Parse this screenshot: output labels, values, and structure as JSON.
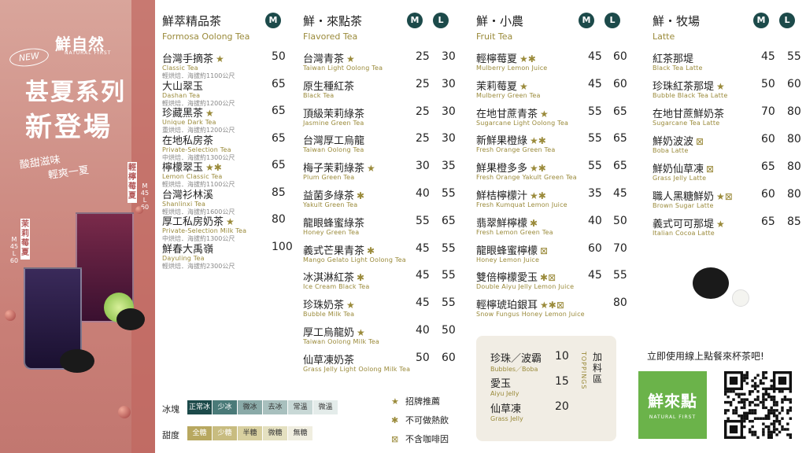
{
  "promo": {
    "logo": "鮮自然",
    "logo_sub": "NATURAL FIRST",
    "new_badge": "NEW",
    "headline_line1": "甚夏系列",
    "headline_line2": "新登場",
    "slogan_line1": "酸甜滋味",
    "slogan_line2": "輕爽一夏",
    "drink1_name": "輕檸莓夏",
    "drink1_sizes": "M 45 L 60",
    "drink2_name": "茉莉莓夏",
    "drink2_sizes": "M 45 L 60"
  },
  "columns": [
    {
      "title": "鮮萃精品茶",
      "subtitle": "Formosa Oolong Tea",
      "sizes": [
        "M"
      ],
      "items": [
        {
          "name": "台灣手摘茶",
          "marks": "★",
          "en": "Classic Tea",
          "note": "輕烘焙．海拔約1100公尺",
          "prices": [
            "50"
          ]
        },
        {
          "name": "大山翠玉",
          "marks": "",
          "en": "Dashan Tea",
          "note": "輕烘焙．海拔約1200公尺",
          "prices": [
            "65"
          ]
        },
        {
          "name": "珍藏黑茶",
          "marks": "★",
          "en": "Unique Dark Tea",
          "note": "重烘焙．海拔約1200公尺",
          "prices": [
            "65"
          ]
        },
        {
          "name": "在地私房茶",
          "marks": "",
          "en": "Private-Selection Tea",
          "note": "中烘焙．海拔約1300公尺",
          "prices": [
            "65"
          ]
        },
        {
          "name": "檸檬翠玉",
          "marks": "★✱",
          "en": "Lemon Classic Tea",
          "note": "輕烘焙．海拔約1100公尺",
          "prices": [
            "65"
          ]
        },
        {
          "name": "台灣衫林溪",
          "marks": "",
          "en": "Shanlinxi Tea",
          "note": "輕烘焙．海拔約1600公尺",
          "prices": [
            "85"
          ]
        },
        {
          "name": "厚工私房奶茶",
          "marks": "★",
          "en": "Private-Selection Milk Tea",
          "note": "中烘焙．海拔約1300公尺",
          "prices": [
            "80"
          ]
        },
        {
          "name": "鮮春大禹嶺",
          "marks": "",
          "en": "Dayuling Tea",
          "note": "輕烘焙．海拔約2300公尺",
          "prices": [
            "100"
          ]
        }
      ]
    },
    {
      "title": "鮮・來點茶",
      "subtitle": "Flavored Tea",
      "sizes": [
        "M",
        "L"
      ],
      "items": [
        {
          "name": "台灣青茶",
          "marks": "★",
          "en": "Taiwan Light Oolong Tea",
          "prices": [
            "25",
            "30"
          ]
        },
        {
          "name": "原生種紅茶",
          "marks": "",
          "en": "Black Tea",
          "prices": [
            "25",
            "30"
          ]
        },
        {
          "name": "頂級茉莉綠茶",
          "marks": "",
          "en": "Jasmine Green Tea",
          "prices": [
            "25",
            "30"
          ]
        },
        {
          "name": "台灣厚工烏龍",
          "marks": "",
          "en": "Taiwan Oolong Tea",
          "prices": [
            "25",
            "30"
          ]
        },
        {
          "name": "梅子茉莉綠茶",
          "marks": "★",
          "en": "Plum Green Tea",
          "prices": [
            "30",
            "35"
          ]
        },
        {
          "name": "益菌多綠茶",
          "marks": "✱",
          "en": "Yakult Green Tea",
          "prices": [
            "40",
            "55"
          ]
        },
        {
          "name": "龍眼蜂蜜綠茶",
          "marks": "",
          "en": "Honey Green Tea",
          "prices": [
            "55",
            "65"
          ]
        },
        {
          "name": "義式芒果青茶",
          "marks": "✱",
          "en": "Mango Gelato Light Oolong Tea",
          "prices": [
            "45",
            "55"
          ]
        },
        {
          "name": "冰淇淋紅茶",
          "marks": "✱",
          "en": "Ice Cream Black Tea",
          "prices": [
            "45",
            "55"
          ]
        },
        {
          "name": "珍珠奶茶",
          "marks": "★",
          "en": "Bubble Milk Tea",
          "prices": [
            "45",
            "55"
          ]
        },
        {
          "name": "厚工烏龍奶",
          "marks": "★",
          "en": "Taiwan Oolong Milk Tea",
          "prices": [
            "40",
            "50"
          ]
        },
        {
          "name": "仙草凍奶茶",
          "marks": "",
          "en": "Grass Jelly Light Oolong Milk Tea",
          "prices": [
            "50",
            "60"
          ]
        }
      ]
    },
    {
      "title": "鮮・小農",
      "subtitle": "Fruit Tea",
      "sizes": [
        "M",
        "L"
      ],
      "items": [
        {
          "name": "輕檸莓夏",
          "marks": "★✱",
          "en": "Mulberry Lemon Juice",
          "prices": [
            "45",
            "60"
          ]
        },
        {
          "name": "茉莉莓夏",
          "marks": "★",
          "en": "Mulberry Green Tea",
          "prices": [
            "45",
            "60"
          ]
        },
        {
          "name": "在地甘蔗青茶",
          "marks": "★",
          "en": "Sugarcane Light Oolong Tea",
          "prices": [
            "55",
            "65"
          ]
        },
        {
          "name": "新鮮果橙綠",
          "marks": "★✱",
          "en": "Fresh Orange Green Tea",
          "prices": [
            "55",
            "65"
          ]
        },
        {
          "name": "鮮果橙多多",
          "marks": "★✱",
          "en": "Fresh Orange Yakult Green Tea",
          "prices": [
            "55",
            "65"
          ]
        },
        {
          "name": "鮮桔檸檬汁",
          "marks": "★✱",
          "en": "Fresh Kumquat Lemon Juice",
          "prices": [
            "35",
            "45"
          ]
        },
        {
          "name": "翡翠鮮檸檬",
          "marks": "✱",
          "en": "Fresh Lemon Green Tea",
          "prices": [
            "40",
            "50"
          ]
        },
        {
          "name": "龍眼蜂蜜檸檬",
          "marks": "⊠",
          "en": "Honey Lemon Juice",
          "prices": [
            "60",
            "70"
          ]
        },
        {
          "name": "雙倍檸檬愛玉",
          "marks": "✱⊠",
          "en": "Double Aiyu Jelly Lemon Juice",
          "prices": [
            "45",
            "55"
          ]
        },
        {
          "name": "輕檸琥珀銀耳",
          "marks": "★✱⊠",
          "en": "Snow Fungus Honey Lemon Juice",
          "prices": [
            "80"
          ]
        }
      ]
    },
    {
      "title": "鮮・牧場",
      "subtitle": "Latte",
      "sizes": [
        "M",
        "L"
      ],
      "items": [
        {
          "name": "紅茶那堤",
          "marks": "",
          "en": "Black Tea Latte",
          "prices": [
            "45",
            "55"
          ]
        },
        {
          "name": "珍珠紅茶那堤",
          "marks": "★",
          "en": "Bubble Black Tea Latte",
          "prices": [
            "50",
            "60"
          ]
        },
        {
          "name": "在地甘蔗鮮奶茶",
          "marks": "",
          "en": "Sugarcane Tea Latte",
          "prices": [
            "70",
            "80"
          ]
        },
        {
          "name": "鮮奶波波",
          "marks": "⊠",
          "en": "Boba Latte",
          "prices": [
            "60",
            "80"
          ]
        },
        {
          "name": "鮮奶仙草凍",
          "marks": "⊠",
          "en": "Grass Jelly Latte",
          "prices": [
            "65",
            "80"
          ]
        },
        {
          "name": "職人黑糖鮮奶",
          "marks": "★⊠",
          "en": "Brown Sugar Latte",
          "prices": [
            "60",
            "80"
          ]
        },
        {
          "name": "義式可可那堤",
          "marks": "★",
          "en": "Italian Cocoa Latte",
          "prices": [
            "65",
            "85"
          ]
        }
      ]
    }
  ],
  "ice": {
    "label": "冰塊",
    "options": [
      "正常冰",
      "少冰",
      "微冰",
      "去冰",
      "常溫",
      "微溫"
    ],
    "colors": [
      "#1c4a4a",
      "#4a7a78",
      "#8aaaa8",
      "#a8c0be",
      "#c8d8d6",
      "#e4ecea"
    ]
  },
  "sugar": {
    "label": "甜度",
    "options": [
      "全糖",
      "少糖",
      "半糖",
      "微糖",
      "無糖"
    ],
    "colors": [
      "#b8a860",
      "#c8bc80",
      "#d8d0a0",
      "#e4e0c0",
      "#f0eee0"
    ]
  },
  "legend": [
    {
      "symbol": "★",
      "text": "招牌推薦"
    },
    {
      "symbol": "✱",
      "text": "不可做熱飲"
    },
    {
      "symbol": "⊠",
      "text": "不含咖啡因"
    }
  ],
  "toppings": {
    "side_label": "加料區",
    "side_en": "TOPPINGS",
    "items": [
      {
        "name": "珍珠／波霸",
        "en": "Bubbles／Boba",
        "price": "10"
      },
      {
        "name": "愛玉",
        "en": "Aiyu Jelly",
        "price": "15"
      },
      {
        "name": "仙草凍",
        "en": "Grass Jelly",
        "price": "20"
      }
    ]
  },
  "order": {
    "text": "立即使用線上點餐來杯茶吧!",
    "brand": "鮮來點",
    "brand_sub": "NATURAL FIRST"
  },
  "colors": {
    "badge": "#1c4a4a",
    "accent_olive": "#9a8a3a",
    "promo_bg": "#cf8f86",
    "brand_green": "#6bb34a"
  }
}
